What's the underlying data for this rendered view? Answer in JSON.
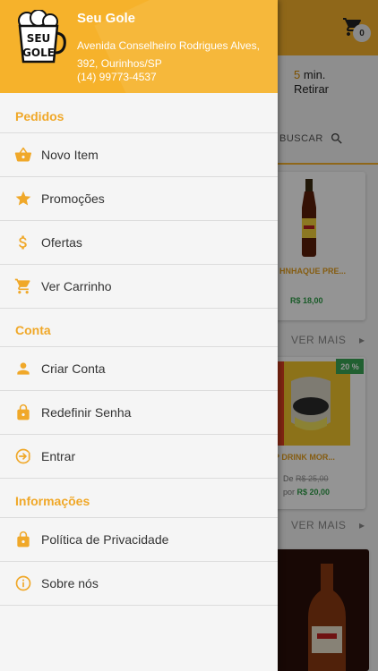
{
  "background": {
    "cart_count": "0",
    "delivery_minutes": "5",
    "delivery_unit": "min.",
    "delivery_mode": "Retirar",
    "search_label": "BUSCAR",
    "products": [
      {
        "name": "HNHAQUE PRE...",
        "price": "R$ 18,00"
      },
      {
        "name": "P DRINK MOR...",
        "discount": "20 %",
        "old_price_label": "De",
        "old_price": "R$ 25,00",
        "new_price_label": "por",
        "new_price": "R$ 20,00"
      }
    ],
    "ver_mais": "VER MAIS"
  },
  "drawer": {
    "store_name": "Seu Gole",
    "address": "Avenida Conselheiro Rodrigues Alves, 392, Ourinhos/SP",
    "phone": "(14) 99773-4537",
    "logo_text_top": "SEU",
    "logo_text_bottom": "GOLE",
    "sections": [
      {
        "title": "Pedidos",
        "items": [
          {
            "label": "Novo Item",
            "icon": "basket-icon"
          },
          {
            "label": "Promoções",
            "icon": "star-icon"
          },
          {
            "label": "Ofertas",
            "icon": "dollar-icon"
          },
          {
            "label": "Ver Carrinho",
            "icon": "cart-icon"
          }
        ]
      },
      {
        "title": "Conta",
        "items": [
          {
            "label": "Criar Conta",
            "icon": "person-icon"
          },
          {
            "label": "Redefinir Senha",
            "icon": "lock-icon"
          },
          {
            "label": "Entrar",
            "icon": "login-icon"
          }
        ]
      },
      {
        "title": "Informações",
        "items": [
          {
            "label": "Política de Privacidade",
            "icon": "lock-icon"
          },
          {
            "label": "Sobre nós",
            "icon": "info-icon"
          }
        ]
      }
    ]
  },
  "colors": {
    "accent": "#f6b22b",
    "section_title": "#f0a829",
    "price_green": "#2e9e48"
  }
}
